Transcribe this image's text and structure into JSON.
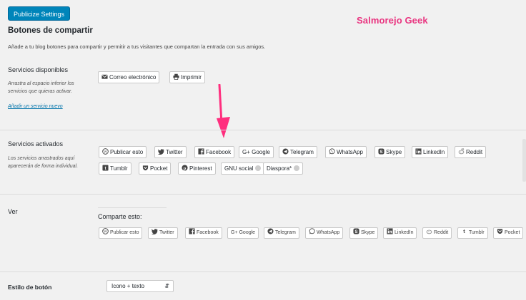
{
  "header": {
    "publicize_button": "Publicize Settings",
    "watermark": "Salmorejo Geek",
    "title": "Botones de compartir",
    "description": "Añade a tu blog botones para compartir y permitir a tus visitantes que compartan la entrada con sus amigos."
  },
  "available": {
    "label": "Servicios disponibles",
    "help": "Arrastra al espacio inferior los servicios que quieras activar.",
    "add_link": "Añadir un servicio nuevo",
    "items": [
      {
        "label": "Correo electrónico",
        "icon": "mail-icon"
      },
      {
        "label": "Imprimir",
        "icon": "printer-icon"
      }
    ]
  },
  "active": {
    "label": "Servicios activados",
    "help": "Los servicios arrastrados aquí aparecerán de forma individual.",
    "row1": [
      {
        "label": "Publicar esto",
        "icon": "wordpress-icon"
      },
      {
        "label": "Twitter",
        "icon": "twitter-icon"
      },
      {
        "label": "Facebook",
        "icon": "facebook-icon"
      },
      {
        "label": "G+ Google",
        "icon": "googleplus-icon"
      },
      {
        "label": "Telegram",
        "icon": "telegram-icon"
      },
      {
        "label": "WhatsApp",
        "icon": "whatsapp-icon"
      },
      {
        "label": "Skype",
        "icon": "skype-icon"
      },
      {
        "label": "LinkedIn",
        "icon": "linkedin-icon"
      },
      {
        "label": "Reddit",
        "icon": "reddit-icon"
      }
    ],
    "row2": [
      {
        "label": "Tumblr",
        "icon": "tumblr-icon"
      },
      {
        "label": "Pocket",
        "icon": "pocket-icon"
      },
      {
        "label": "Pinterest",
        "icon": "pinterest-icon"
      },
      {
        "label": "GNU social",
        "icon": "remove-icon"
      },
      {
        "label": "Diaspora*",
        "icon": "remove-icon"
      }
    ]
  },
  "preview": {
    "label": "Ver",
    "share_title": "Comparte esto:",
    "items": [
      {
        "label": "Publicar esto",
        "icon": "wordpress-icon"
      },
      {
        "label": "Twitter",
        "icon": "twitter-icon"
      },
      {
        "label": "Facebook",
        "icon": "facebook-icon"
      },
      {
        "label": "G+ Google",
        "icon": "googleplus-icon"
      },
      {
        "label": "Telegram",
        "icon": "telegram-icon"
      },
      {
        "label": "WhatsApp",
        "icon": "whatsapp-icon"
      },
      {
        "label": "Skype",
        "icon": "skype-icon"
      },
      {
        "label": "LinkedIn",
        "icon": "linkedin-icon"
      },
      {
        "label": "Reddit",
        "icon": "reddit-icon"
      },
      {
        "label": "Tumblr",
        "icon": "tumblr-icon"
      },
      {
        "label": "Pocket",
        "icon": "pocket-icon"
      }
    ]
  },
  "button_style": {
    "label": "Estilo de botón",
    "value": "Icono + texto"
  },
  "colors": {
    "primary": "#0085ba",
    "link": "#0073aa",
    "watermark": "#e93580",
    "arrow": "#ff2e7e"
  }
}
